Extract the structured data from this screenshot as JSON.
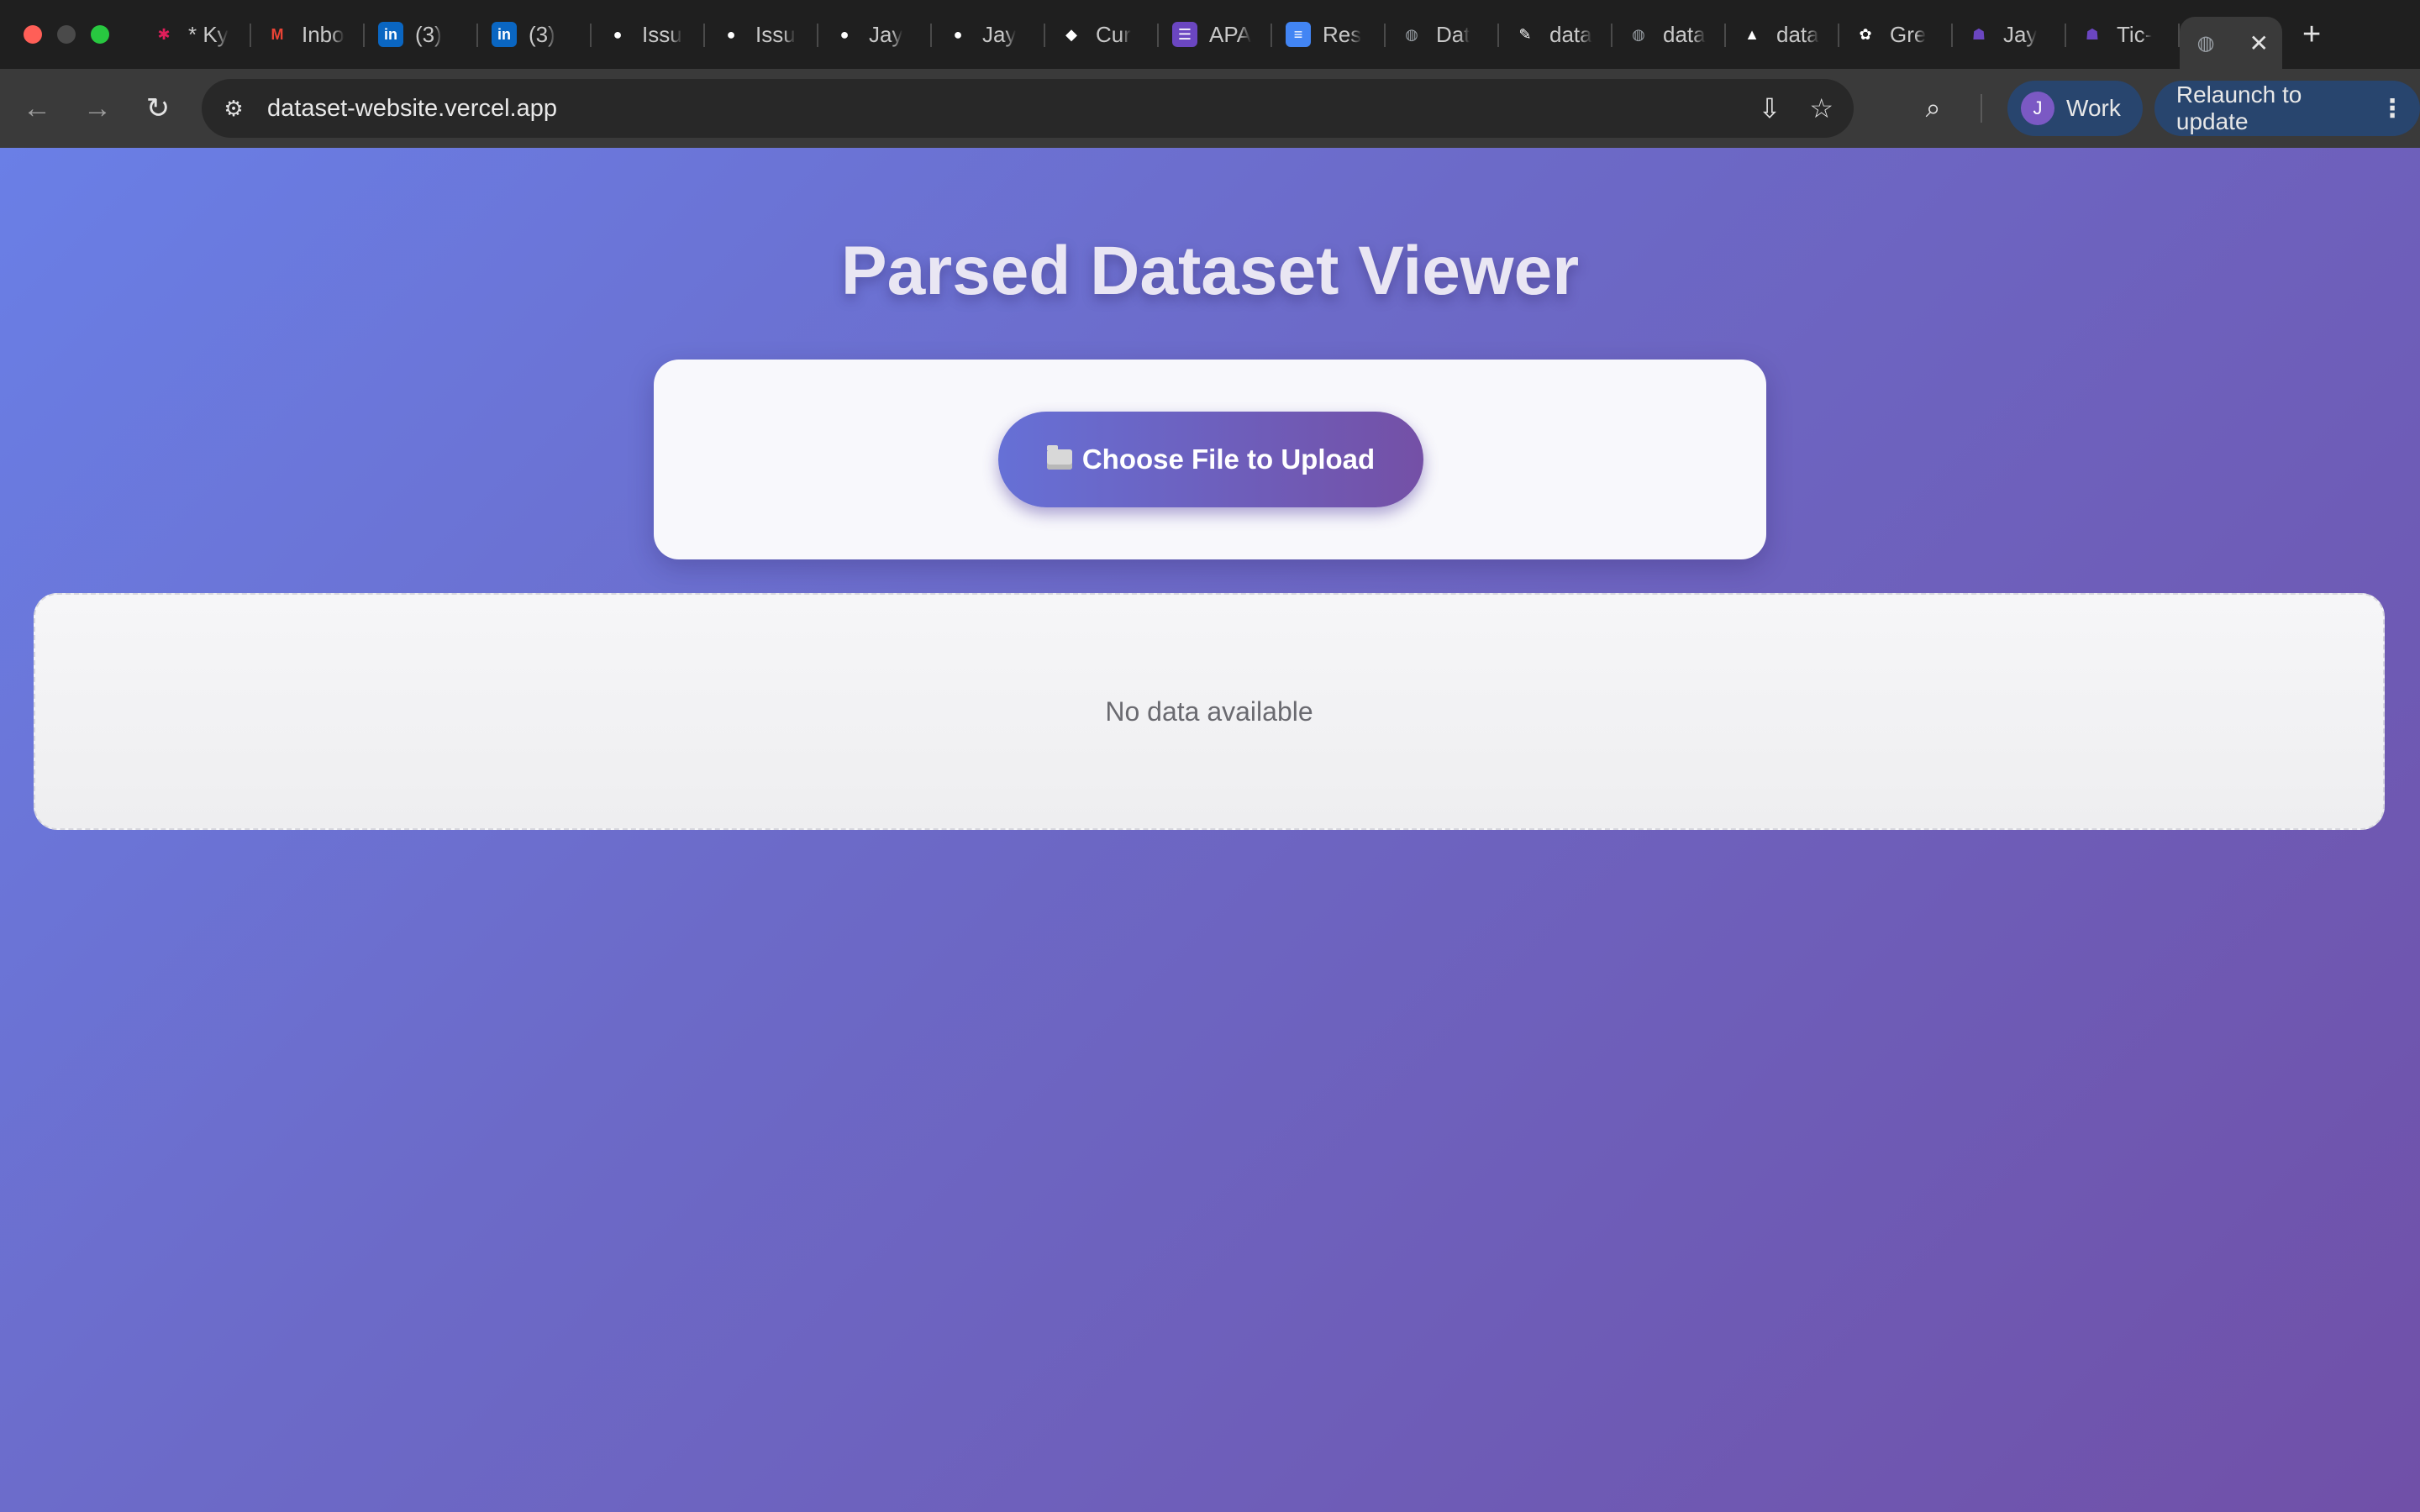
{
  "window_controls": {
    "close_color": "#ff5f57",
    "minimize_color": "#4a4a4a",
    "maximize_color": "#28c840"
  },
  "tabs": [
    {
      "title": "* Ky",
      "icon": "slack-icon",
      "color": "#e01e5a"
    },
    {
      "title": "Inbo",
      "icon": "gmail-icon",
      "color": "#ea4335"
    },
    {
      "title": "(3)",
      "icon": "linkedin-icon",
      "color": "#0a66c2"
    },
    {
      "title": "(3)",
      "icon": "linkedin-icon",
      "color": "#0a66c2"
    },
    {
      "title": "Issu",
      "icon": "github-icon",
      "color": "#ffffff"
    },
    {
      "title": "Issu",
      "icon": "github-icon",
      "color": "#ffffff"
    },
    {
      "title": "Jay",
      "icon": "github-icon",
      "color": "#ffffff"
    },
    {
      "title": "Jay",
      "icon": "github-icon",
      "color": "#ffffff"
    },
    {
      "title": "Cur",
      "icon": "cursor-icon",
      "color": "#ffffff"
    },
    {
      "title": "APA",
      "icon": "list-icon",
      "color": "#6b46c1"
    },
    {
      "title": "Res",
      "icon": "docs-icon",
      "color": "#4285f4"
    },
    {
      "title": "Dat",
      "icon": "globe-icon",
      "color": "#9aa0a6"
    },
    {
      "title": "data",
      "icon": "huggingface-icon",
      "color": "#ffffff"
    },
    {
      "title": "data",
      "icon": "globe-icon",
      "color": "#9aa0a6"
    },
    {
      "title": "data",
      "icon": "vercel-icon",
      "color": "#ffffff"
    },
    {
      "title": "Gre",
      "icon": "openai-icon",
      "color": "#ffffff"
    },
    {
      "title": "Jay",
      "icon": "alien-icon",
      "color": "#6b46c1"
    },
    {
      "title": "Tic-",
      "icon": "alien-icon",
      "color": "#6b46c1"
    }
  ],
  "active_tab": {
    "icon": "globe-icon",
    "close": "✕"
  },
  "new_tab": "+",
  "toolbar": {
    "back": "←",
    "forward": "→",
    "reload": "↻",
    "url": "dataset-website.vercel.app",
    "install": "⇩",
    "bookmark": "☆",
    "lens": "⌕",
    "profile_initial": "J",
    "profile_label": "Work",
    "relaunch_label": "Relaunch to update",
    "menu": "⋮"
  },
  "page": {
    "title": "Parsed Dataset Viewer",
    "upload_button": "Choose File to Upload",
    "empty_message": "No data available"
  }
}
